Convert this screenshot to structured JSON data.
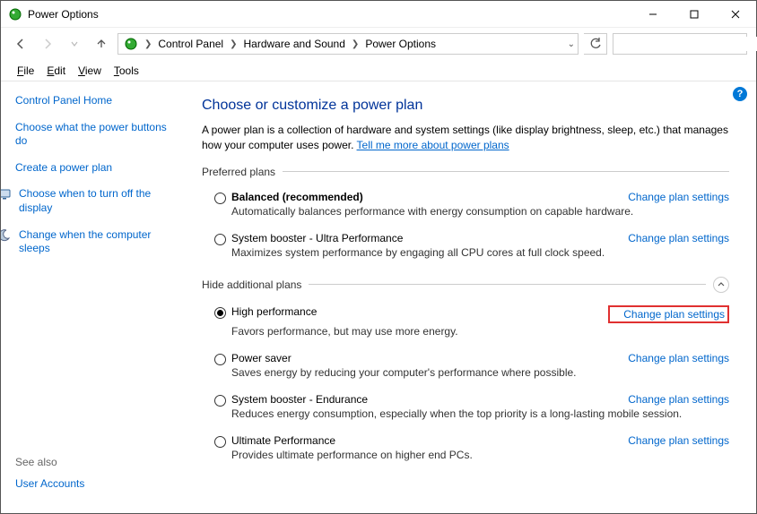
{
  "window": {
    "title": "Power Options"
  },
  "breadcrumb": {
    "seg1": "Control Panel",
    "seg2": "Hardware and Sound",
    "seg3": "Power Options"
  },
  "menu": {
    "file": "File",
    "edit": "Edit",
    "view": "View",
    "tools": "Tools"
  },
  "sidebar": {
    "home": "Control Panel Home",
    "choose_buttons": "Choose what the power buttons do",
    "create_plan": "Create a power plan",
    "turn_off_display": "Choose when to turn off the display",
    "change_sleep": "Change when the computer sleeps",
    "see_also_head": "See also",
    "user_accounts": "User Accounts"
  },
  "main": {
    "heading": "Choose or customize a power plan",
    "intro_text": "A power plan is a collection of hardware and system settings (like display brightness, sleep, etc.) that manages how your computer uses power. ",
    "intro_link": "Tell me more about power plans",
    "preferred_head": "Preferred plans",
    "additional_head": "Hide additional plans",
    "change_link_label": "Change plan settings"
  },
  "plans_preferred": [
    {
      "name": "Balanced (recommended)",
      "desc": "Automatically balances performance with energy consumption on capable hardware.",
      "bold": true,
      "checked": false
    },
    {
      "name": "System booster - Ultra Performance",
      "desc": "Maximizes system performance by engaging all CPU cores at full clock speed.",
      "bold": false,
      "checked": false
    }
  ],
  "plans_additional": [
    {
      "name": "High performance",
      "desc": "Favors performance, but may use more energy.",
      "bold": false,
      "checked": true,
      "highlight": true
    },
    {
      "name": "Power saver",
      "desc": "Saves energy by reducing your computer's performance where possible.",
      "bold": false,
      "checked": false
    },
    {
      "name": "System booster - Endurance",
      "desc": "Reduces energy consumption, especially when the top priority is a long-lasting mobile session.",
      "bold": false,
      "checked": false
    },
    {
      "name": "Ultimate Performance",
      "desc": "Provides ultimate performance on higher end PCs.",
      "bold": false,
      "checked": false
    }
  ]
}
